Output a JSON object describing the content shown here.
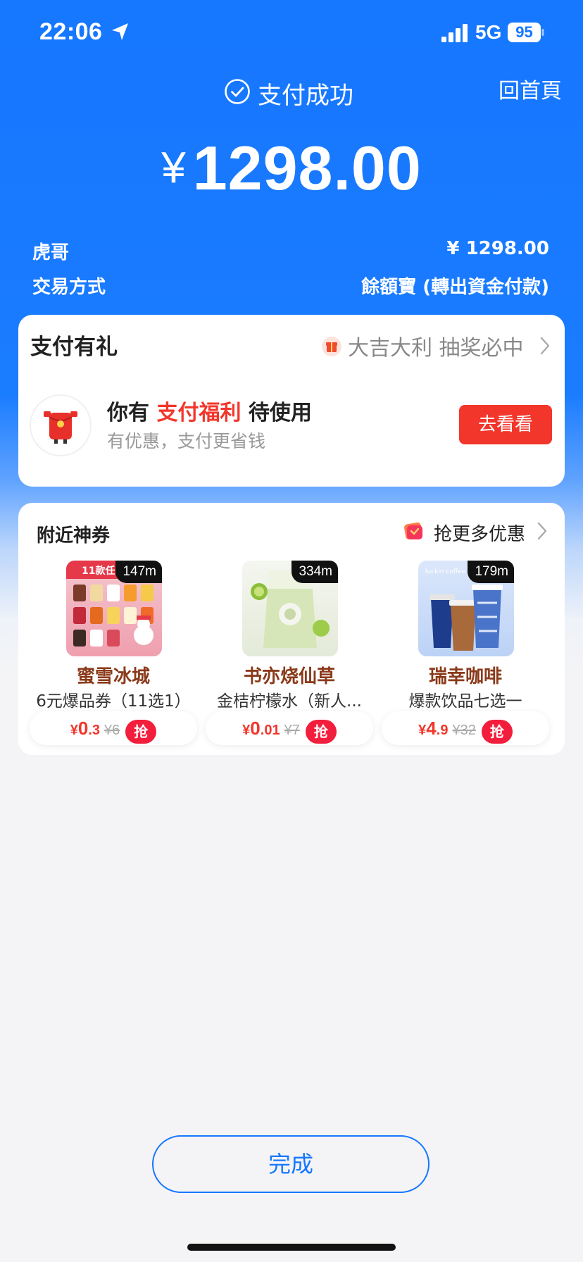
{
  "status": {
    "time": "22:06",
    "network": "5G",
    "battery": "95"
  },
  "header": {
    "title": "支付成功",
    "home_link": "回首頁"
  },
  "payment": {
    "currency": "¥",
    "amount": "1298.00"
  },
  "details": {
    "payee_label": "虎哥",
    "payee_value": "¥ 1298.00",
    "method_label": "交易方式",
    "method_value": "餘額寶 (轉出資金付款)"
  },
  "promo": {
    "title": "支付有礼",
    "lottery_text": "大吉大利 抽奖必中",
    "line1_prefix": "你有",
    "line1_highlight": "支付福利",
    "line1_suffix": "待使用",
    "line2": "有优惠，支付更省钱",
    "button": "去看看"
  },
  "nearby": {
    "title": "附近神券",
    "more": "抢更多优惠",
    "coupons": [
      {
        "distance": "147m",
        "img_tag": "11款任",
        "name": "蜜雪冰城",
        "desc": "6元爆品券（11选1）",
        "currency": "¥",
        "price_int": "0",
        "price_dec": ".3",
        "original": "¥6",
        "grab": "抢"
      },
      {
        "distance": "334m",
        "name": "书亦烧仙草",
        "desc": "金桔柠檬水（新人...",
        "currency": "¥",
        "price_int": "0",
        "price_dec": ".01",
        "original": "¥7",
        "grab": "抢"
      },
      {
        "distance": "179m",
        "img_tag": "luckin coffee",
        "name": "瑞幸咖啡",
        "desc": "爆款饮品七选一",
        "currency": "¥",
        "price_int": "4",
        "price_dec": ".9",
        "original": "¥32",
        "grab": "抢"
      }
    ]
  },
  "footer": {
    "done": "完成"
  },
  "colors": {
    "brand_blue": "#1677ff",
    "accent_red": "#f2362b",
    "brown": "#8a3a1a"
  }
}
